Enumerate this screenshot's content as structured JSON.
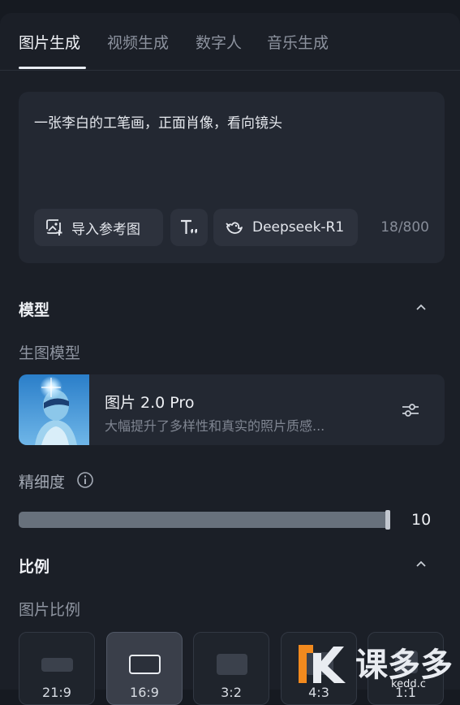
{
  "tabs": [
    {
      "label": "图片生成",
      "active": true
    },
    {
      "label": "视频生成",
      "active": false
    },
    {
      "label": "数字人",
      "active": false
    },
    {
      "label": "音乐生成",
      "active": false
    }
  ],
  "prompt": {
    "text": "一张李白的工笔画，正面肖像，看向镜头",
    "import_ref_label": "导入参考图",
    "text_format_icon": "text-format-icon",
    "model_chip_label": "Deepseek-R1",
    "counter": "18/800"
  },
  "model_section": {
    "title": "模型",
    "sublabel": "生图模型",
    "model_name": "图片 2.0 Pro",
    "model_desc": "大幅提升了多样性和真实的照片质感..."
  },
  "detail": {
    "label": "精细度",
    "value": "10",
    "level_fraction": 1.0
  },
  "ratio_section": {
    "title": "比例",
    "sublabel": "图片比例",
    "options": [
      {
        "label": "21:9",
        "selected": false
      },
      {
        "label": "16:9",
        "selected": true
      },
      {
        "label": "3:2",
        "selected": false
      },
      {
        "label": "4:3",
        "selected": false
      },
      {
        "label": "1:1",
        "selected": false
      }
    ]
  },
  "watermark": {
    "text": "课多多",
    "url": "kedd.c"
  },
  "colors": {
    "background": "#1b1f27",
    "card": "#232832",
    "accent_orange": "#f28a1e"
  }
}
